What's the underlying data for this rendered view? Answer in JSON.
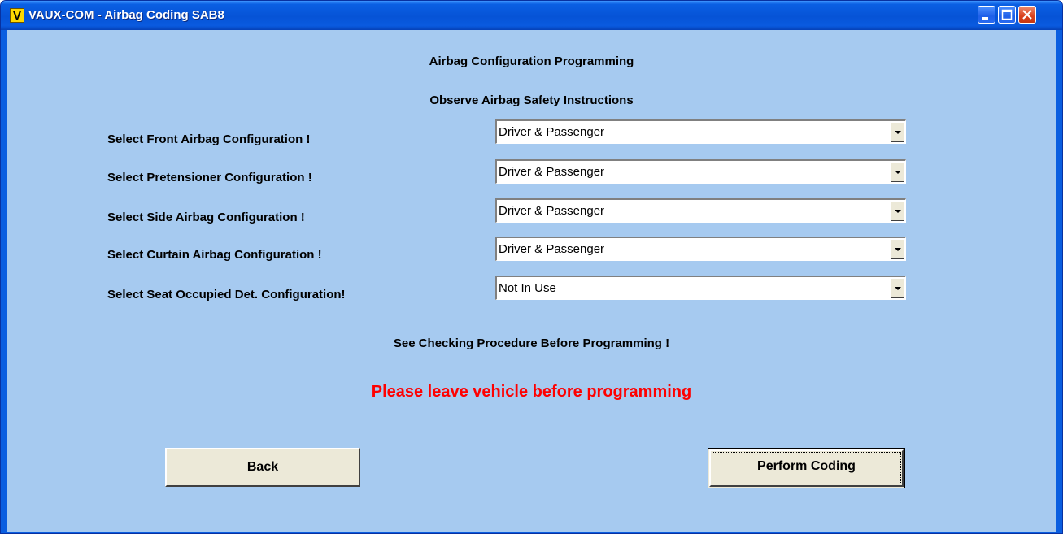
{
  "window": {
    "title": "VAUX-COM - Airbag Coding SAB8",
    "app_icon_letter": "V",
    "icons": [
      "app-icon",
      "minimize-icon",
      "maximize-icon",
      "close-icon"
    ]
  },
  "header": {
    "title": "Airbag Configuration Programming",
    "subtitle": "Observe Airbag Safety Instructions"
  },
  "config_rows": [
    {
      "label": "Select Front Airbag Configuration !",
      "value": "Driver & Passenger"
    },
    {
      "label": "Select Pretensioner Configuration !",
      "value": "Driver & Passenger"
    },
    {
      "label": "Select Side Airbag Configuration !",
      "value": "Driver & Passenger"
    },
    {
      "label": "Select Curtain Airbag Configuration !",
      "value": "Driver & Passenger"
    },
    {
      "label": "Select Seat Occupied Det. Configuration!",
      "value": "Not In Use"
    }
  ],
  "notice": "See Checking Procedure Before Programming !",
  "warning": "Please leave vehicle before programming",
  "buttons": {
    "back": "Back",
    "perform": "Perform Coding"
  },
  "colors": {
    "client_background": "#a6caf0",
    "warning_text": "#ff0000",
    "titlebar": "#0a5ee0"
  }
}
